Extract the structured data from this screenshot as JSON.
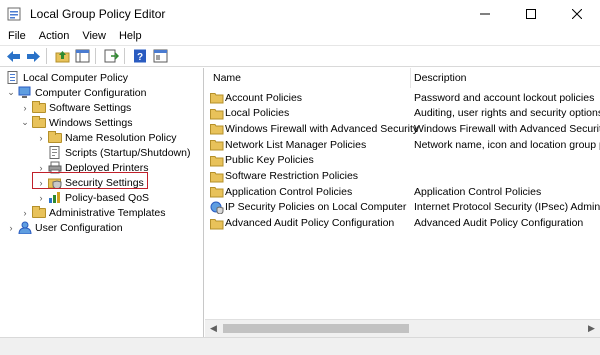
{
  "window": {
    "title": "Local Group Policy Editor",
    "minimize_icon": "minimize-icon",
    "maximize_icon": "maximize-icon",
    "close_icon": "close-icon"
  },
  "menu": [
    "File",
    "Action",
    "View",
    "Help"
  ],
  "toolbar": {
    "icons": [
      "back-arrow-icon",
      "forward-arrow-icon",
      "up-folder-icon",
      "show-hide-tree-icon",
      "export-list-icon",
      "help-icon",
      "properties-icon"
    ]
  },
  "tree": {
    "root": "Local Computer Policy",
    "computer_config": "Computer Configuration",
    "software_settings": "Software Settings",
    "windows_settings": "Windows Settings",
    "name_resolution": "Name Resolution Policy",
    "scripts": "Scripts (Startup/Shutdown)",
    "deployed_printers": "Deployed Printers",
    "security_settings": "Security Settings",
    "qos": "Policy-based QoS",
    "admin_templates": "Administrative Templates",
    "user_config": "User Configuration"
  },
  "list": {
    "col_name": "Name",
    "col_description": "Description",
    "rows": [
      {
        "name": "Account Policies",
        "description": "Password and account lockout policies",
        "icon": "folder-icon"
      },
      {
        "name": "Local Policies",
        "description": "Auditing, user rights and security options p",
        "icon": "folder-icon"
      },
      {
        "name": "Windows Firewall with Advanced Security",
        "description": "Windows Firewall with Advanced Security",
        "icon": "folder-icon"
      },
      {
        "name": "Network List Manager Policies",
        "description": "Network name, icon and location group po",
        "icon": "folder-icon"
      },
      {
        "name": "Public Key Policies",
        "description": "",
        "icon": "folder-icon"
      },
      {
        "name": "Software Restriction Policies",
        "description": "",
        "icon": "folder-icon"
      },
      {
        "name": "Application Control Policies",
        "description": "Application Control Policies",
        "icon": "folder-icon"
      },
      {
        "name": "IP Security Policies on Local Computer",
        "description": "Internet Protocol Security (IPsec) Administ",
        "icon": "ipsec-shield-icon"
      },
      {
        "name": "Advanced Audit Policy Configuration",
        "description": "Advanced Audit Policy Configuration",
        "icon": "folder-icon"
      }
    ]
  },
  "colors": {
    "highlight_border": "#c0202a",
    "folder": "#e8c25a"
  }
}
